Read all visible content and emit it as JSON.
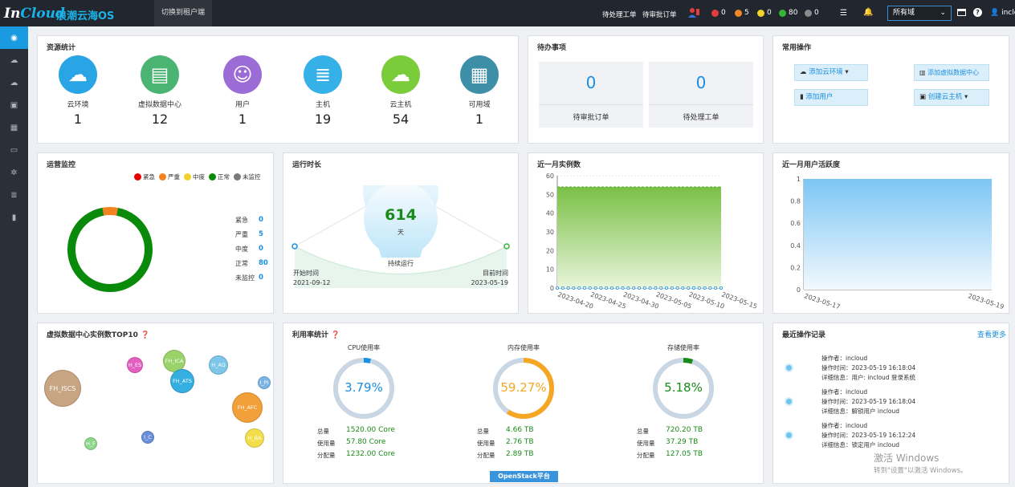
{
  "topbar": {
    "logo_a": "In",
    "logo_b": "Cloud",
    "logo_cn": "浪潮云海OS",
    "switch": "切换到租户端",
    "pending_orders": "待处理工单",
    "review_orders": "待审批订单",
    "alarms": [
      {
        "count": "0",
        "color": "#e23c3c"
      },
      {
        "count": "5",
        "color": "#f0882a"
      },
      {
        "count": "0",
        "color": "#f2d22a"
      },
      {
        "count": "80",
        "color": "#34b534"
      },
      {
        "count": "0",
        "color": "#8a8a8a"
      }
    ],
    "region": "所有域",
    "user": "inclo"
  },
  "sidebar": {
    "items": [
      "dashboard-icon",
      "cloud-icon",
      "cloud-alt-icon",
      "camera-icon",
      "calendar-icon",
      "monitor-icon",
      "gear-icon",
      "database-icon",
      "trash-icon"
    ]
  },
  "resources": {
    "title": "资源统计",
    "items": [
      {
        "label": "云环境",
        "value": "1",
        "color": "#29a5e6",
        "icon": "cloud-icon"
      },
      {
        "label": "虚拟数据中心",
        "value": "12",
        "color": "#4bb473",
        "icon": "monitor-icon"
      },
      {
        "label": "用户",
        "value": "1",
        "color": "#9b6cd6",
        "icon": "user-icon"
      },
      {
        "label": "主机",
        "value": "19",
        "color": "#35b1e8",
        "icon": "server-icon"
      },
      {
        "label": "云主机",
        "value": "54",
        "color": "#7bcc3a",
        "icon": "cloud-host-icon"
      },
      {
        "label": "可用域",
        "value": "1",
        "color": "#3d8fa8",
        "icon": "chip-icon"
      }
    ]
  },
  "todo": {
    "title": "待办事项",
    "items": [
      {
        "value": "0",
        "label": "待审批订单"
      },
      {
        "value": "0",
        "label": "待处理工单"
      }
    ]
  },
  "ops": {
    "title": "常用操作",
    "add_cloud": "添加云环境",
    "add_vdc": "添加虚拟数据中心",
    "add_user": "添加用户",
    "create_vm": "创建云主机"
  },
  "monitor": {
    "title": "运营监控",
    "legend": [
      {
        "name": "紧急",
        "color": "#e60000"
      },
      {
        "name": "严重",
        "color": "#f58220"
      },
      {
        "name": "中度",
        "color": "#f2d22a"
      },
      {
        "name": "正常",
        "color": "#0a8a0a"
      },
      {
        "name": "未监控",
        "color": "#7a7a7a"
      }
    ],
    "stats": [
      {
        "name": "紧急",
        "value": "0"
      },
      {
        "name": "严重",
        "value": "5"
      },
      {
        "name": "中度",
        "value": "0"
      },
      {
        "name": "正常",
        "value": "80"
      },
      {
        "name": "未监控",
        "value": "0"
      }
    ]
  },
  "uptime": {
    "title": "运行时长",
    "days": "614",
    "unit": "天",
    "status": "持续运行",
    "start_label": "开始时间",
    "start": "2021-09-12",
    "end_label": "目前时间",
    "end": "2023-05-19"
  },
  "instances": {
    "title": "近一月实例数"
  },
  "users_active": {
    "title": "近一月用户活跃度"
  },
  "vdc_top": {
    "title": "虚拟数据中心实例数TOP10",
    "bubbles": [
      {
        "label": "FH_ISCS",
        "color": "#c8a582"
      },
      {
        "label": "FH_ICA",
        "color": "#9ad36a"
      },
      {
        "label": "FH_ATS",
        "color": "#35aee0"
      },
      {
        "label": "H_ES",
        "color": "#e35fc0"
      },
      {
        "label": "H_AQ",
        "color": "#7cc7e8"
      },
      {
        "label": "I_PI",
        "color": "#7ab5e6"
      },
      {
        "label": "FH_AFC",
        "color": "#f2a13a"
      },
      {
        "label": "H_BA",
        "color": "#f2dd4a"
      },
      {
        "label": "I_C",
        "color": "#6a8fd8"
      },
      {
        "label": "H_F",
        "color": "#8ed68a"
      }
    ]
  },
  "util": {
    "title": "利用率统计",
    "gauges": [
      {
        "name": "CPU使用率",
        "pct": "3.79%",
        "ratio": 0.0379,
        "color": "#1a8ee0",
        "total": "1520.00 Core",
        "used": "57.80 Core",
        "alloc": "1232.00 Core"
      },
      {
        "name": "内存使用率",
        "pct": "59.27%",
        "ratio": 0.5927,
        "color": "#f5a623",
        "total": "4.66 TB",
        "used": "2.76 TB",
        "alloc": "2.89 TB"
      },
      {
        "name": "存储使用率",
        "pct": "5.18%",
        "ratio": 0.0518,
        "color": "#1a8a1a",
        "total": "720.20 TB",
        "used": "37.29 TB",
        "alloc": "127.05 TB"
      }
    ],
    "total_label": "总量",
    "used_label": "使用量",
    "alloc_label": "分配量",
    "platform": "OpenStack平台"
  },
  "logs": {
    "title": "最近操作记录",
    "more": "查看更多",
    "items": [
      {
        "op": "操作者：incloud",
        "time": "操作时间：2023-05-19 16:18:04",
        "detail": "详细信息：用户: incloud 登录系统"
      },
      {
        "op": "操作者：incloud",
        "time": "操作时间：2023-05-19 16:18:04",
        "detail": "详细信息：解锁用户 incloud"
      },
      {
        "op": "操作者：incloud",
        "time": "操作时间：2023-05-19 16:12:24",
        "detail": "详细信息：锁定用户 incloud"
      }
    ]
  },
  "watermark": {
    "line1": "激活 Windows",
    "line2": "转到\"设置\"以激活 Windows。"
  },
  "chart_data": [
    {
      "type": "area",
      "title": "近一月实例数",
      "x": [
        "2023-04-20",
        "2023-04-25",
        "2023-04-30",
        "2023-05-05",
        "2023-05-10",
        "2023-05-15"
      ],
      "series": [
        {
          "values": [
            54,
            54,
            54,
            54,
            54,
            54
          ]
        },
        {
          "values": [
            0,
            0,
            0,
            0,
            0,
            0
          ]
        }
      ],
      "yticks": [
        "0",
        "10",
        "20",
        "30",
        "40",
        "50",
        "60"
      ],
      "ylim": [
        0,
        60
      ]
    },
    {
      "type": "area",
      "title": "近一月用户活跃度",
      "x": [
        "2023-05-17",
        "2023-05-19"
      ],
      "series": [
        {
          "values": [
            1,
            1
          ]
        }
      ],
      "yticks": [
        "0",
        "0.2",
        "0.4",
        "0.6",
        "0.8",
        "1"
      ],
      "ylim": [
        0,
        1
      ]
    },
    {
      "type": "pie",
      "title": "运营监控",
      "categories": [
        "紧急",
        "严重",
        "中度",
        "正常",
        "未监控"
      ],
      "values": [
        0,
        5,
        0,
        80,
        0
      ]
    }
  ]
}
